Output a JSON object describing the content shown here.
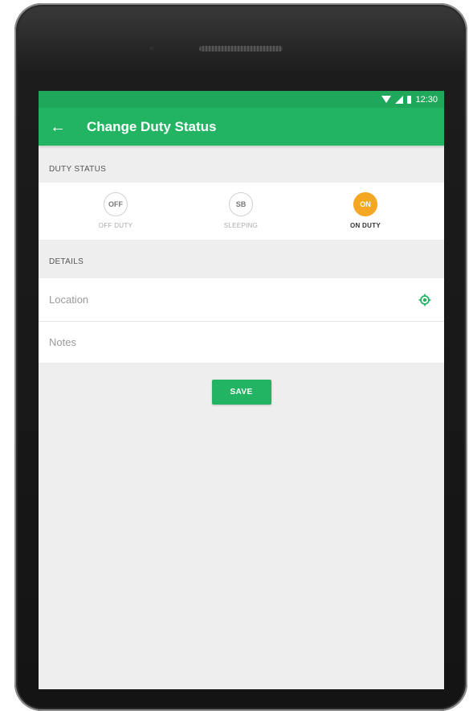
{
  "status_bar": {
    "time": "12:30",
    "icons": [
      "wifi-icon",
      "signal-icon",
      "battery-icon"
    ]
  },
  "app_bar": {
    "back_icon": "arrow-left-icon",
    "back_glyph": "←",
    "title": "Change Duty Status"
  },
  "duty_status": {
    "section_label": "DUTY STATUS",
    "options": [
      {
        "code": "OFF",
        "label": "OFF DUTY",
        "selected": false
      },
      {
        "code": "SB",
        "label": "SLEEPING",
        "selected": false
      },
      {
        "code": "ON",
        "label": "ON DUTY",
        "selected": true
      }
    ]
  },
  "details": {
    "section_label": "DETAILS",
    "location_placeholder": "Location",
    "location_icon": "location-target-icon",
    "notes_placeholder": "Notes"
  },
  "actions": {
    "save_label": "SAVE"
  },
  "colors": {
    "primary": "#22b463",
    "status_bar": "#1fa85b",
    "active_status": "#f5a623",
    "background": "#eeeeee"
  }
}
